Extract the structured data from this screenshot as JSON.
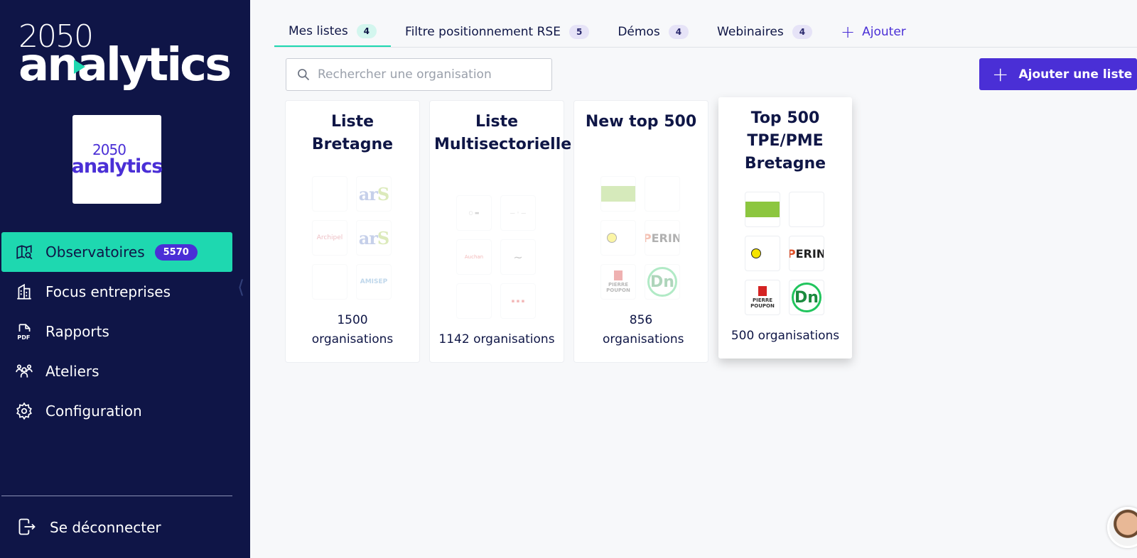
{
  "brand": {
    "year": "2050",
    "word": "analytics"
  },
  "org_logo": {
    "year": "2050",
    "word": "analytics"
  },
  "nav": [
    {
      "label": "Observatoires",
      "badge": "5570",
      "icon": "map-search-icon",
      "active": true
    },
    {
      "label": "Focus entreprises",
      "icon": "building-icon"
    },
    {
      "label": "Rapports",
      "icon": "pdf-icon"
    },
    {
      "label": "Ateliers",
      "icon": "users-icon"
    },
    {
      "label": "Configuration",
      "icon": "gear-icon"
    }
  ],
  "logout": {
    "label": "Se déconnecter",
    "icon": "logout-icon"
  },
  "tabs": [
    {
      "label": "Mes listes",
      "count": "4"
    },
    {
      "label": "Filtre positionnement RSE",
      "count": "5"
    },
    {
      "label": "Démos",
      "count": "4"
    },
    {
      "label": "Webinaires",
      "count": "4"
    }
  ],
  "add_tab": {
    "label": "Ajouter"
  },
  "search": {
    "placeholder": "Rechercher une organisation"
  },
  "add_list_button": {
    "label": "Ajouter une liste"
  },
  "cards": [
    {
      "title": "Liste Bretagne",
      "count": "1500 organisations"
    },
    {
      "title": "Liste Multisectorielle",
      "count": "1142 organisations"
    },
    {
      "title": "New top 500",
      "count": "856 organisations"
    },
    {
      "title": "Top 500 TPE/PME Bretagne",
      "count": "500 organisations"
    }
  ],
  "logo_texts": {
    "ars": "ar",
    "ars_s": "S",
    "archipel": "Archipel",
    "amisep": "AMISEP",
    "auchan": "Auchan",
    "perin": "ERIN",
    "perin_p": "P",
    "poupon": "PIERRE POUPON",
    "dn": "Dn"
  }
}
